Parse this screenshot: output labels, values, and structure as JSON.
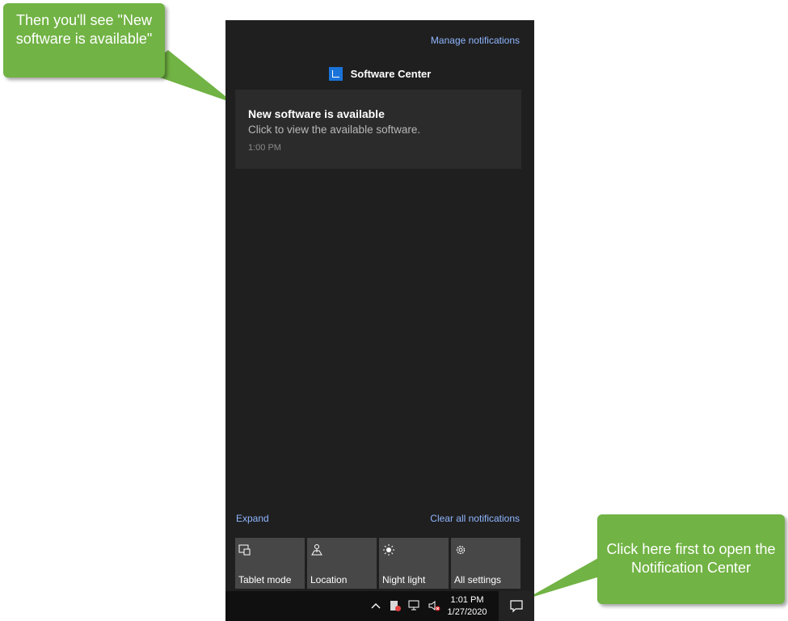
{
  "panel": {
    "manage_notifications": "Manage notifications",
    "app_name": "Software Center",
    "notification": {
      "title": "New software is available",
      "body": "Click to view the available software.",
      "time": "1:00 PM"
    },
    "expand": "Expand",
    "clear_all": "Clear all notifications",
    "quick_actions": [
      {
        "label": "Tablet mode",
        "icon": "tablet-mode-icon"
      },
      {
        "label": "Location",
        "icon": "location-icon"
      },
      {
        "label": "Night light",
        "icon": "night-light-icon"
      },
      {
        "label": "All settings",
        "icon": "gear-icon"
      }
    ]
  },
  "taskbar": {
    "time": "1:01 PM",
    "date": "1/27/2020",
    "tray_icons": [
      "chevron-up-icon",
      "software-center-tray-icon",
      "network-icon",
      "volume-muted-icon"
    ],
    "action_center_icon": "action-center-icon"
  },
  "callouts": {
    "top": "Then you'll see \"New software is available\"",
    "bottom": "Click here first to open the Notification Center"
  },
  "colors": {
    "panel_bg": "#1f1f1f",
    "card_bg": "#2b2b2b",
    "tile_bg": "#474747",
    "link": "#8fb6ff",
    "callout": "#71b344",
    "app_icon": "#1a73d9"
  }
}
